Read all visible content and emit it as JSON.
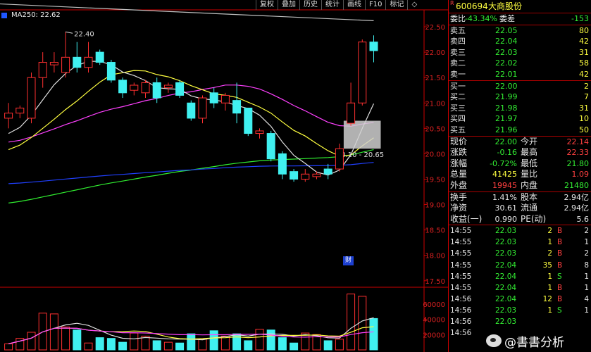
{
  "toolbar": {
    "buttons": [
      "复权",
      "叠加",
      "历史",
      "统计",
      "画线",
      "F10",
      "标记",
      "◇"
    ]
  },
  "chart": {
    "ma_label": "MA250: 22.62",
    "price_axis": [
      "22.50",
      "22.00",
      "21.50",
      "21.00",
      "20.50",
      "20.00",
      "19.50",
      "19.00",
      "18.50",
      "18.00",
      "17.50"
    ],
    "volume_axis": [
      "60000",
      "40000",
      "20000"
    ],
    "high_marker": "22.40",
    "range_label": "20.10 - 20.65",
    "event_tag": "财",
    "colors": {
      "up": "#ff3030",
      "down": "#40f0f0",
      "ma5": "#e0e0e0",
      "ma10": "#ffff40",
      "ma20": "#ff40ff",
      "ma60": "#30ee30",
      "ma120": "#2040ff",
      "ma250": "#c0c0c0"
    }
  },
  "chart_data": {
    "type": "candlestick",
    "ylim": [
      17.4,
      22.75
    ],
    "candles": [
      {
        "o": 20.7,
        "c": 20.8,
        "h": 21.0,
        "l": 20.5
      },
      {
        "o": 20.8,
        "c": 20.9,
        "h": 20.95,
        "l": 20.7
      },
      {
        "o": 20.7,
        "c": 21.5,
        "h": 21.6,
        "l": 20.6
      },
      {
        "o": 21.5,
        "c": 21.8,
        "h": 22.0,
        "l": 21.3
      },
      {
        "o": 21.75,
        "c": 21.8,
        "h": 22.0,
        "l": 21.6
      },
      {
        "o": 21.6,
        "c": 21.9,
        "h": 22.4,
        "l": 21.5
      },
      {
        "o": 21.9,
        "c": 21.7,
        "h": 22.2,
        "l": 21.6
      },
      {
        "o": 21.7,
        "c": 21.9,
        "h": 22.2,
        "l": 21.6
      },
      {
        "o": 22.0,
        "c": 21.8,
        "h": 22.05,
        "l": 21.75
      },
      {
        "o": 21.8,
        "c": 21.45,
        "h": 21.85,
        "l": 21.4
      },
      {
        "o": 21.45,
        "c": 21.2,
        "h": 21.5,
        "l": 21.1
      },
      {
        "o": 21.25,
        "c": 21.35,
        "h": 21.4,
        "l": 21.15
      },
      {
        "o": 21.2,
        "c": 21.4,
        "h": 21.45,
        "l": 21.1
      },
      {
        "o": 21.4,
        "c": 21.1,
        "h": 21.5,
        "l": 21.0
      },
      {
        "o": 21.3,
        "c": 21.35,
        "h": 21.4,
        "l": 21.2
      },
      {
        "o": 21.4,
        "c": 21.15,
        "h": 21.45,
        "l": 21.1
      },
      {
        "o": 21.0,
        "c": 20.7,
        "h": 21.05,
        "l": 20.65
      },
      {
        "o": 20.7,
        "c": 21.1,
        "h": 21.15,
        "l": 20.6
      },
      {
        "o": 21.2,
        "c": 21.0,
        "h": 21.3,
        "l": 20.9
      },
      {
        "o": 21.0,
        "c": 21.15,
        "h": 21.2,
        "l": 20.85
      },
      {
        "o": 21.05,
        "c": 20.8,
        "h": 21.4,
        "l": 20.6
      },
      {
        "o": 20.9,
        "c": 20.4,
        "h": 20.9,
        "l": 20.35
      },
      {
        "o": 20.4,
        "c": 20.45,
        "h": 20.5,
        "l": 20.3
      },
      {
        "o": 20.4,
        "c": 19.9,
        "h": 20.45,
        "l": 19.85
      },
      {
        "o": 20.0,
        "c": 19.6,
        "h": 20.05,
        "l": 19.5
      },
      {
        "o": 19.65,
        "c": 19.5,
        "h": 19.7,
        "l": 19.45
      },
      {
        "o": 19.5,
        "c": 19.6,
        "h": 19.7,
        "l": 19.45
      },
      {
        "o": 19.55,
        "c": 19.6,
        "h": 19.65,
        "l": 19.5
      },
      {
        "o": 19.7,
        "c": 19.6,
        "h": 19.8,
        "l": 19.5
      },
      {
        "o": 19.7,
        "c": 20.1,
        "h": 20.2,
        "l": 19.65
      },
      {
        "o": 20.6,
        "c": 21.0,
        "h": 21.4,
        "l": 20.55
      },
      {
        "o": 21.0,
        "c": 22.2,
        "h": 22.25,
        "l": 20.95
      },
      {
        "o": 22.2,
        "c": 22.03,
        "h": 22.33,
        "l": 21.8
      }
    ],
    "volume": [
      8000,
      15000,
      23000,
      48000,
      47000,
      30000,
      26000,
      9000,
      16000,
      15000,
      10000,
      22000,
      18000,
      12000,
      10000,
      9000,
      21000,
      14000,
      25000,
      18000,
      21000,
      12000,
      27000,
      26000,
      16000,
      9000,
      22000,
      20000,
      12000,
      14000,
      73000,
      70000,
      41000
    ],
    "ma250": [
      22.95,
      22.62
    ],
    "volume_ylim": [
      0,
      80000
    ]
  },
  "panel": {
    "code": "600694",
    "name": "大商股份",
    "weibi_label": "委比",
    "weibi_value": "-43.34%",
    "weicha_label": "委差",
    "weicha_value": "-153",
    "sells": [
      {
        "label": "卖五",
        "price": "22.05",
        "vol": "80"
      },
      {
        "label": "卖四",
        "price": "22.04",
        "vol": "42"
      },
      {
        "label": "卖三",
        "price": "22.03",
        "vol": "31"
      },
      {
        "label": "卖二",
        "price": "22.02",
        "vol": "58"
      },
      {
        "label": "卖一",
        "price": "22.01",
        "vol": "42"
      }
    ],
    "buys": [
      {
        "label": "买一",
        "price": "22.00",
        "vol": "2"
      },
      {
        "label": "买二",
        "price": "21.99",
        "vol": "7"
      },
      {
        "label": "买三",
        "price": "21.98",
        "vol": "31"
      },
      {
        "label": "买四",
        "price": "21.97",
        "vol": "10"
      },
      {
        "label": "买五",
        "price": "21.96",
        "vol": "50"
      }
    ],
    "quotes": [
      {
        "l1": "现价",
        "v1": "22.00",
        "l2": "今开",
        "v2": "22.14"
      },
      {
        "l1": "涨跌",
        "v1": "-0.16",
        "l2": "最高",
        "v2": "22.33"
      },
      {
        "l1": "涨幅",
        "v1": "-0.72%",
        "l2": "最低",
        "v2": "21.80"
      },
      {
        "l1": "总量",
        "v1": "41425",
        "l2": "量比",
        "v2": "1.09"
      },
      {
        "l1": "外盘",
        "v1": "19945",
        "l2": "内盘",
        "v2": "21480"
      }
    ],
    "stats": [
      {
        "l1": "换手",
        "v1": "1.41%",
        "l2": "股本",
        "v2": "2.94亿"
      },
      {
        "l1": "净资",
        "v1": "30.61",
        "l2": "流通",
        "v2": "2.94亿"
      },
      {
        "l1": "收益(一)",
        "v1": "0.990",
        "l2": "PE(动)",
        "v2": "5.6"
      }
    ],
    "trades": [
      {
        "t": "14:55",
        "p": "22.03",
        "v": "2",
        "s": "B",
        "n": "2"
      },
      {
        "t": "14:55",
        "p": "22.03",
        "v": "1",
        "s": "B",
        "n": "1"
      },
      {
        "t": "14:55",
        "p": "22.03",
        "v": "2",
        "s": "B",
        "n": "2"
      },
      {
        "t": "14:55",
        "p": "22.04",
        "v": "35",
        "s": "B",
        "n": "8"
      },
      {
        "t": "14:55",
        "p": "22.04",
        "v": "1",
        "s": "S",
        "n": "1"
      },
      {
        "t": "14:55",
        "p": "22.04",
        "v": "1",
        "s": "B",
        "n": "1"
      },
      {
        "t": "14:56",
        "p": "22.04",
        "v": "12",
        "s": "B",
        "n": "4"
      },
      {
        "t": "14:56",
        "p": "22.03",
        "v": "1",
        "s": "S",
        "n": "1"
      },
      {
        "t": "14:56",
        "p": "22.03",
        "v": "",
        "s": "",
        "n": ""
      },
      {
        "t": "14:56",
        "p": "",
        "v": "",
        "s": "",
        "n": ""
      }
    ]
  },
  "watermark": "@書書分析"
}
